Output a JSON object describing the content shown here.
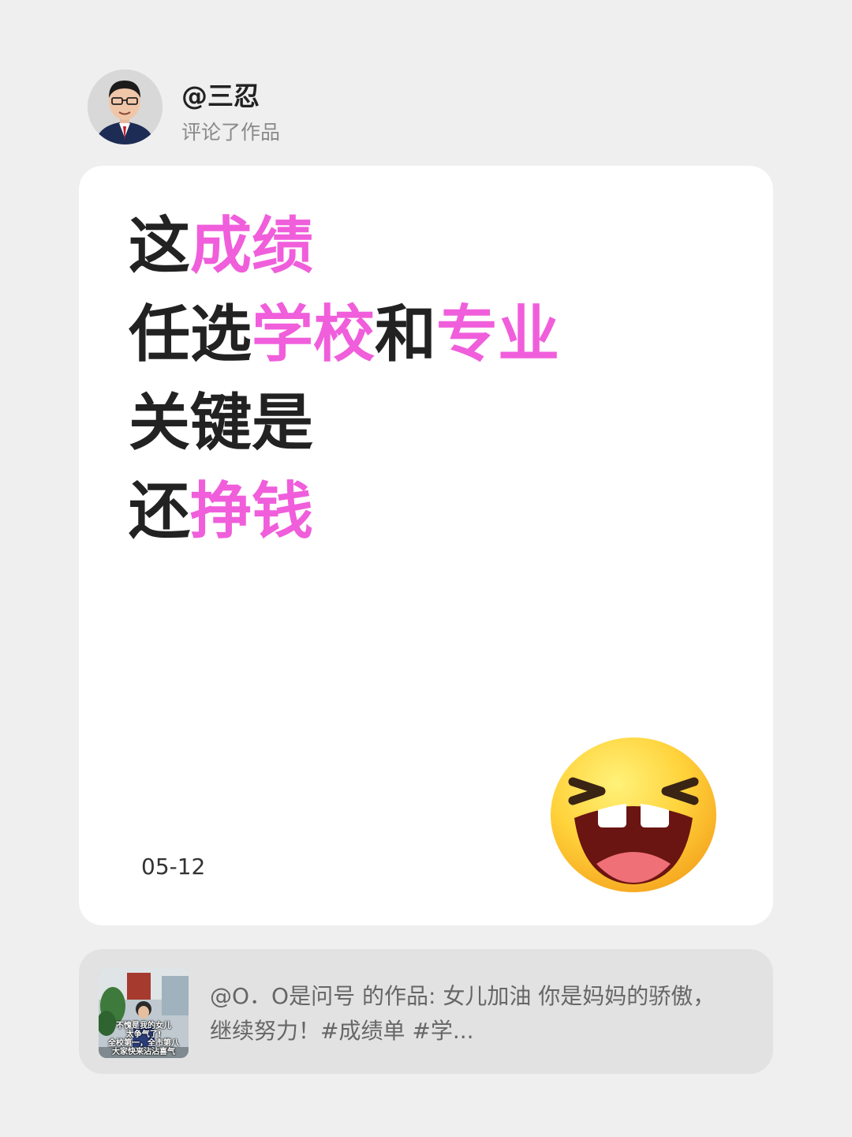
{
  "user": {
    "name": "@三忍",
    "action": "评论了作品"
  },
  "comment": {
    "lines": [
      [
        {
          "text": "这",
          "hl": false
        },
        {
          "text": "成绩",
          "hl": true
        }
      ],
      [
        {
          "text": "任选",
          "hl": false
        },
        {
          "text": "学校",
          "hl": true
        },
        {
          "text": "和",
          "hl": false
        },
        {
          "text": "专业",
          "hl": true
        }
      ],
      [
        {
          "text": "关键是",
          "hl": false
        }
      ],
      [
        {
          "text": "还",
          "hl": false
        },
        {
          "text": "挣钱",
          "hl": true
        }
      ]
    ],
    "date": "05-12",
    "emoji": "laughing-face-emoji"
  },
  "source": {
    "thumbnail_caption_lines": [
      "不愧是我的女儿",
      "太争气了!",
      "全校第一，全市第八",
      "大家快来沾沾喜气"
    ],
    "text": "@O．O是问号 的作品: 女儿加油 你是妈妈的骄傲，继续努力！#成绩单 #学..."
  },
  "colors": {
    "background": "#efefef",
    "card": "#ffffff",
    "text": "#222222",
    "highlight": "#f05edb",
    "muted": "#8a8a8a",
    "source_bar": "#e2e2e2"
  }
}
